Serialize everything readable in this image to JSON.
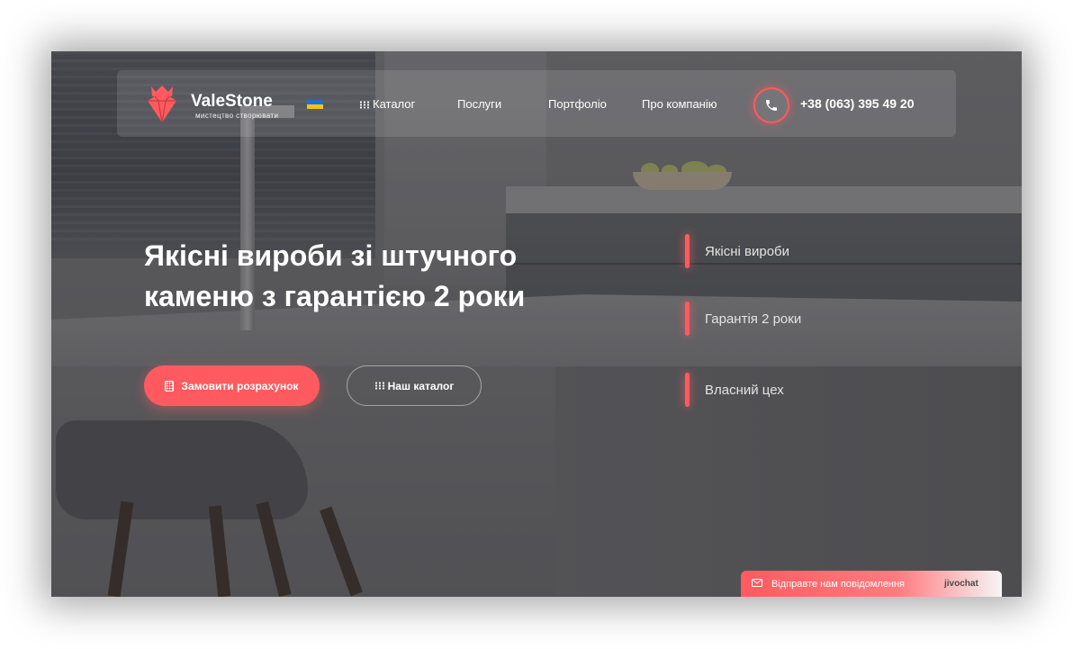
{
  "header": {
    "brand_name": "ValeStone",
    "brand_tagline": "мистецтво створювати",
    "nav": {
      "catalog": "Каталог",
      "services": "Послуги",
      "portfolio": "Портфоліо",
      "about": "Про компанію"
    },
    "phone": "+38 (063) 395 49 20",
    "language_flag": "ukraine-flag-icon"
  },
  "hero": {
    "title_line1": "Якісні вироби зі штучного",
    "title_line2": "каменю з гарантією 2 роки",
    "primary_button": "Замовити розрахунок",
    "secondary_button": "Наш каталог"
  },
  "features": [
    {
      "label": "Якісні вироби"
    },
    {
      "label": "Гарантія 2 роки"
    },
    {
      "label": "Власний цех"
    }
  ],
  "chat_widget": {
    "label": "Відправте нам повідомлення",
    "brand": "jivochat"
  },
  "colors": {
    "accent": "#ff5a5f",
    "text": "#ffffff"
  }
}
